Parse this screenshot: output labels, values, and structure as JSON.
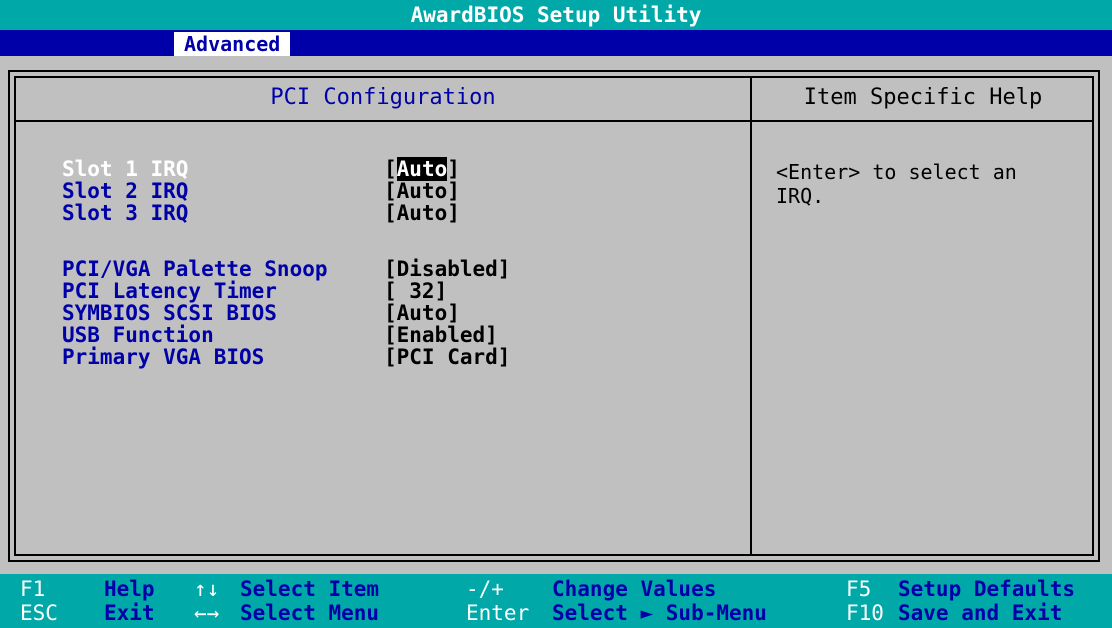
{
  "window": {
    "title": "AwardBIOS Setup Utility"
  },
  "menu": {
    "active_tab": "Advanced"
  },
  "left_panel": {
    "title": "PCI Configuration",
    "settings": [
      {
        "label": "Slot 1 IRQ",
        "value_prefix": "[",
        "value_highlight": "Auto",
        "value_suffix": "]",
        "selected": true
      },
      {
        "label": "Slot 2 IRQ",
        "value": "[Auto]"
      },
      {
        "label": "Slot 3 IRQ",
        "value": "[Auto]"
      },
      {
        "label": "PCI/VGA Palette Snoop",
        "value": "[Disabled]"
      },
      {
        "label": "PCI Latency Timer",
        "value": "[ 32]"
      },
      {
        "label": "SYMBIOS SCSI BIOS",
        "value": "[Auto]"
      },
      {
        "label": "USB Function",
        "value": "[Enabled]"
      },
      {
        "label": "Primary VGA BIOS",
        "value": "[PCI Card]"
      }
    ]
  },
  "right_panel": {
    "title": "Item Specific Help",
    "help_text": "<Enter> to select an\nIRQ."
  },
  "footer": {
    "row1": [
      {
        "key": "F1",
        "action": "Help"
      },
      {
        "key": "↑↓",
        "action": "Select Item"
      },
      {
        "key": "-/+",
        "action": "Change Values"
      },
      {
        "key": "F5",
        "action": "Setup Defaults"
      }
    ],
    "row2": [
      {
        "key": "ESC",
        "action": "Exit"
      },
      {
        "key": "←→",
        "action": "Select Menu"
      },
      {
        "key": "Enter",
        "action": "Select ► Sub-Menu"
      },
      {
        "key": "F10",
        "action": "Save and Exit"
      }
    ]
  },
  "colors": {
    "title_bar": "#00a8a8",
    "menu_bar": "#0000a8",
    "panel_bg": "#c0c0c0",
    "label_text": "#0000a8",
    "footer_bg": "#00a8a8"
  }
}
